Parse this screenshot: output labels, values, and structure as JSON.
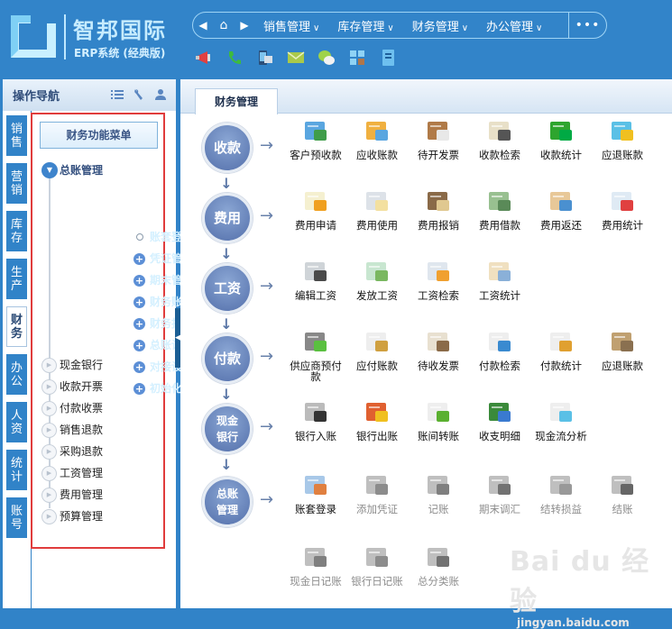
{
  "header": {
    "brand": "智邦国际",
    "subtitle": "ERP系统 (经典版)",
    "nav": {
      "back_icon": "caret-left-icon",
      "home_icon": "home-icon",
      "forward_icon": "caret-right-icon",
      "menus": [
        {
          "label": "销售管理"
        },
        {
          "label": "库存管理"
        },
        {
          "label": "财务管理"
        },
        {
          "label": "办公管理"
        }
      ],
      "more_label": "•••"
    },
    "quick_icons": [
      "megaphone-icon",
      "phone-icon",
      "mobile-icon",
      "mail-icon",
      "wechat-icon",
      "grid-icon",
      "notebook-icon"
    ]
  },
  "sidebar": {
    "title": "操作导航",
    "tools": [
      "list-icon",
      "wrench-icon",
      "user-icon"
    ],
    "vertical_tabs": [
      {
        "label": "销售",
        "active": false
      },
      {
        "label": "营销",
        "active": false
      },
      {
        "label": "库存",
        "active": false
      },
      {
        "label": "生产",
        "active": false
      },
      {
        "label": "财务",
        "active": true
      },
      {
        "label": "办公",
        "active": false
      },
      {
        "label": "人资",
        "active": false
      },
      {
        "label": "统计",
        "active": false
      },
      {
        "label": "账号",
        "active": false
      }
    ],
    "menu_title": "财务功能菜单",
    "tree": {
      "root": "总账管理",
      "children": [
        {
          "label": "账套登录",
          "type": "leaf"
        },
        {
          "label": "凭证管理",
          "type": "plus"
        },
        {
          "label": "期末管理",
          "type": "plus"
        },
        {
          "label": "财务账表",
          "type": "plus"
        },
        {
          "label": "财务报表",
          "type": "plus"
        },
        {
          "label": "总账设置",
          "type": "plus"
        },
        {
          "label": "对接设置",
          "type": "plus"
        },
        {
          "label": "初始化",
          "type": "plus"
        }
      ],
      "groups": [
        "现金银行",
        "收款开票",
        "付款收票",
        "销售退款",
        "采购退款",
        "工资管理",
        "费用管理",
        "预算管理"
      ]
    }
  },
  "main": {
    "tab": "财务管理",
    "flow": [
      {
        "node": "收款",
        "items": [
          "客户预收款",
          "应收账款",
          "待开发票",
          "收款检索",
          "收款统计",
          "应退账款"
        ]
      },
      {
        "node": "费用",
        "items": [
          "费用申请",
          "费用使用",
          "费用报销",
          "费用借款",
          "费用返还",
          "费用统计"
        ]
      },
      {
        "node": "工资",
        "items": [
          "编辑工资",
          "发放工资",
          "工资检索",
          "工资统计"
        ]
      },
      {
        "node": "付款",
        "items": [
          "供应商预付款",
          "应付账款",
          "待收发票",
          "付款检索",
          "付款统计",
          "应退账款"
        ]
      },
      {
        "node": "现金银行",
        "items": [
          "银行入账",
          "银行出账",
          "账间转账",
          "收支明细",
          "现金流分析"
        ]
      },
      {
        "node": "总账管理",
        "items": [
          "账套登录",
          "添加凭证",
          "记账",
          "期末调汇",
          "结转损益",
          "结账",
          "现金日记账",
          "银行日记账",
          "总分类账"
        ]
      }
    ]
  },
  "watermark": {
    "logo": "Bai du 经验",
    "url": "jingyan.baidu.com"
  }
}
